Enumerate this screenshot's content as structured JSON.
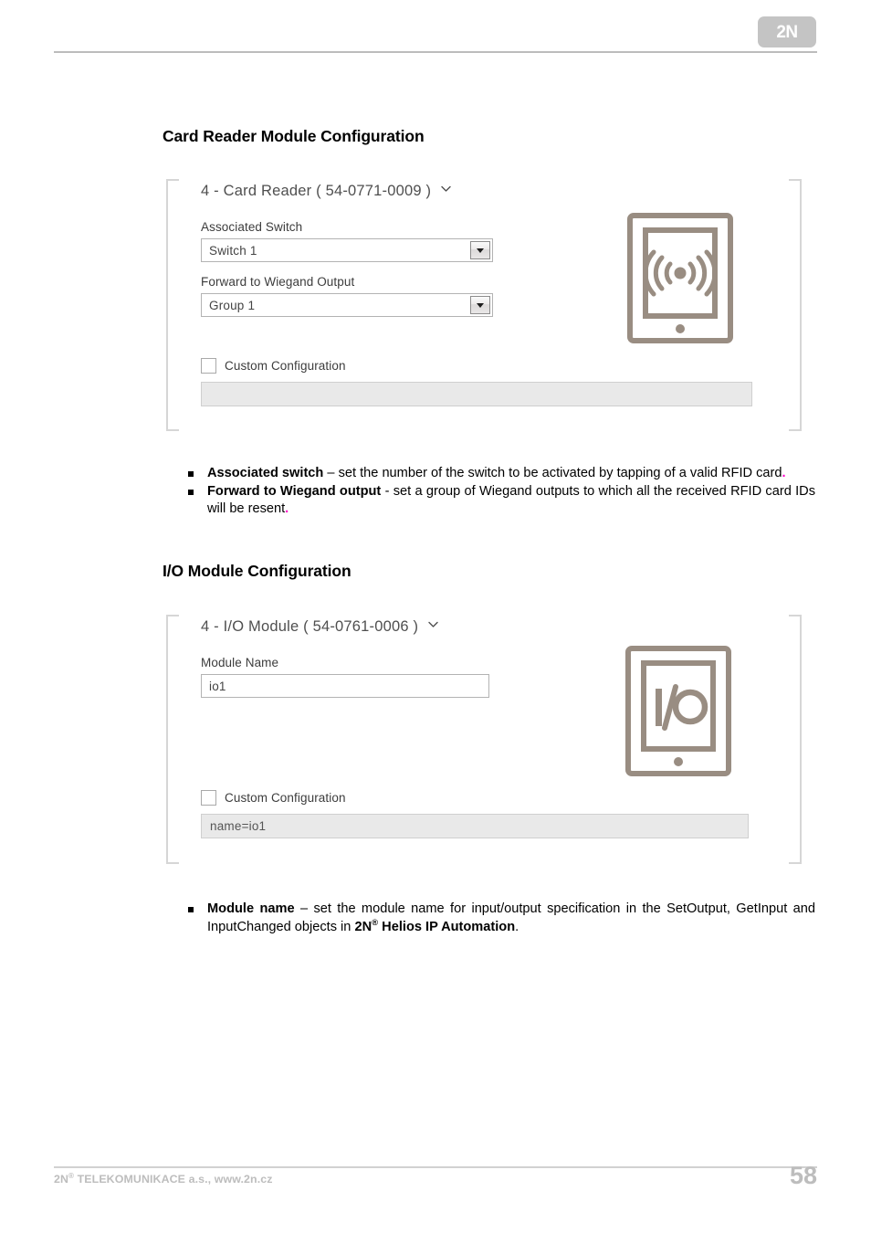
{
  "header": {
    "logo_text": "2N"
  },
  "sections": [
    {
      "heading": "Card Reader Module Configuration",
      "panel": {
        "title": "4 - Card Reader ( 54-0771-0009 )",
        "collapse_icon": "chevron-down-icon",
        "fields": [
          {
            "label": "Associated Switch",
            "type": "select",
            "value": "Switch 1"
          },
          {
            "label": "Forward to Wiegand Output",
            "type": "select",
            "value": "Group 1"
          }
        ],
        "custom_config": {
          "checkbox_label": "Custom Configuration",
          "checked": false,
          "value": ""
        },
        "device_icon": "card-reader-rfid-icon"
      },
      "bullets": [
        {
          "lead": "Associated switch",
          "dash": " – ",
          "text": "set the number of the switch to be activated by tapping of a valid RFID card",
          "end_punct": "."
        },
        {
          "lead": "Forward to Wiegand output",
          "dash": " - ",
          "text": "set a group of Wiegand outputs to which all the received RFID card IDs will be resent",
          "end_punct": "."
        }
      ]
    },
    {
      "heading": "I/O Module Configuration",
      "panel": {
        "title": "4 - I/O Module ( 54-0761-0006 )",
        "collapse_icon": "chevron-down-icon",
        "fields": [
          {
            "label": "Module Name",
            "type": "text",
            "value": "io1"
          }
        ],
        "custom_config": {
          "checkbox_label": "Custom Configuration",
          "checked": false,
          "value": "name=io1"
        },
        "device_icon": "io-module-icon"
      },
      "bullets": [
        {
          "lead": "Module name",
          "dash": " – ",
          "text_part1": "set the module name for input/output specification in the SetOutput, GetInput and InputChanged objects in ",
          "brand": "2N",
          "brand_sup": "®",
          "brand_rest": " Helios IP Automation",
          "end_punct": "."
        }
      ]
    }
  ],
  "footer": {
    "company": "2N",
    "company_sup": "®",
    "company_rest": " TELEKOMUNIKACE a.s., www.2n.cz",
    "page_number": "58"
  },
  "colors": {
    "accent_pink": "#ff00c8",
    "device_icon": "#998d82",
    "panel_border": "#d6d6d6",
    "footer_gray": "#bdbdbd"
  }
}
